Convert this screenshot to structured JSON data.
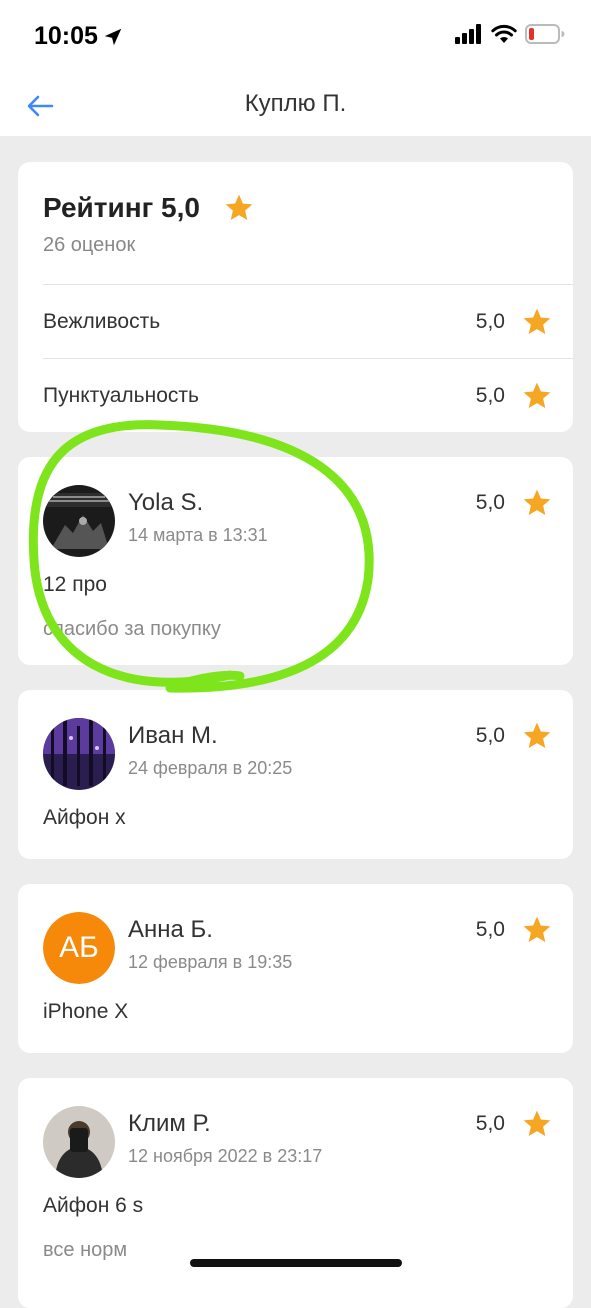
{
  "status_bar": {
    "time": "10:05"
  },
  "nav": {
    "title": "Куплю П."
  },
  "rating": {
    "title": "Рейтинг 5,0",
    "count": "26 оценок",
    "categories": [
      {
        "label": "Вежливость",
        "value": "5,0"
      },
      {
        "label": "Пунктуальность",
        "value": "5,0"
      }
    ]
  },
  "reviews": [
    {
      "name": "Yola S.",
      "date": "14 марта в 13:31",
      "score": "5,0",
      "text": "12 про",
      "comment": "спасибо за покупку"
    },
    {
      "name": "Иван М.",
      "date": "24 февраля в 20:25",
      "score": "5,0",
      "text": "Айфон х"
    },
    {
      "name": "Анна Б.",
      "initials": "АБ",
      "date": "12 февраля в 19:35",
      "score": "5,0",
      "text": "iPhone X"
    },
    {
      "name": "Клим Р.",
      "date": "12 ноября 2022 в 23:17",
      "score": "5,0",
      "text": "Айфон 6 s",
      "comment": "все норм"
    }
  ],
  "colors": {
    "accent": "#3d8af7",
    "star": "#f5a623",
    "annotation": "#7ee51c",
    "avatar_initials_bg": "#f6890a"
  },
  "icons": [
    "location-arrow-icon",
    "signal-icon",
    "wifi-icon",
    "battery-icon",
    "back-arrow-icon",
    "star-icon"
  ]
}
